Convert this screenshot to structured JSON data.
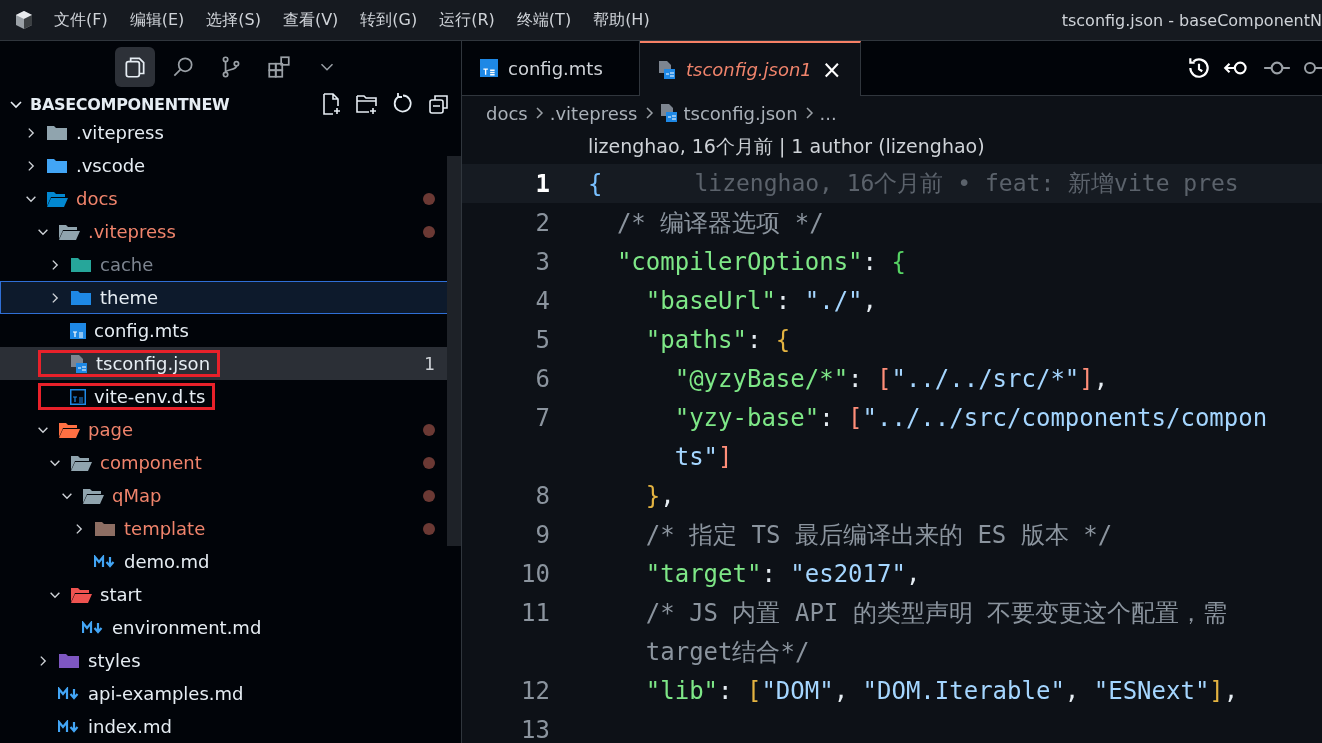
{
  "menu": [
    "文件(F)",
    "编辑(E)",
    "选择(S)",
    "查看(V)",
    "转到(G)",
    "运行(R)",
    "终端(T)",
    "帮助(H)"
  ],
  "window": {
    "title": "tsconfig.json - baseComponentN"
  },
  "activity": [
    {
      "kind": "files",
      "selected": true
    },
    {
      "kind": "search",
      "selected": false
    },
    {
      "kind": "source-control",
      "selected": false
    },
    {
      "kind": "extensions",
      "selected": false
    },
    {
      "kind": "chevron",
      "selected": false
    }
  ],
  "explorer": {
    "title": "BASECOMPONENTNEW",
    "tree": [
      {
        "name": ".vitepress",
        "kind": "folder",
        "expanded": false,
        "modified": false,
        "selected": false
      },
      {
        "name": ".vscode",
        "kind": "folder-vscode",
        "expanded": false,
        "modified": false,
        "selected": false
      },
      {
        "name": "docs",
        "kind": "folder-docs",
        "expanded": true,
        "modified": true,
        "selected": false,
        "children": [
          {
            "name": ".vitepress",
            "kind": "folder",
            "expanded": true,
            "modified": true,
            "selected": false,
            "children": [
              {
                "name": "cache",
                "kind": "folder-cache",
                "expanded": false,
                "modified": false,
                "ignored": true,
                "selected": false
              },
              {
                "name": "theme",
                "kind": "folder-theme",
                "expanded": false,
                "modified": false,
                "focused": true,
                "selected": false
              },
              {
                "name": "config.mts",
                "kind": "ts",
                "modified": false,
                "selected": false
              },
              {
                "name": "tsconfig.json",
                "kind": "tsconfig",
                "modified": false,
                "selected": true,
                "problems": "1",
                "marked": true
              },
              {
                "name": "vite-env.d.ts",
                "kind": "ts-outline",
                "modified": false,
                "selected": false,
                "marked": true
              }
            ]
          },
          {
            "name": "page",
            "kind": "folder-page",
            "expanded": true,
            "modified": true,
            "selected": false,
            "children": [
              {
                "name": "component",
                "kind": "folder",
                "expanded": true,
                "modified": true,
                "selected": false,
                "children": [
                  {
                    "name": "qMap",
                    "kind": "folder",
                    "expanded": true,
                    "modified": true,
                    "selected": false,
                    "children": [
                      {
                        "name": "template",
                        "kind": "folder-template",
                        "expanded": false,
                        "modified": true,
                        "selected": false
                      },
                      {
                        "name": "demo.md",
                        "kind": "md",
                        "modified": false,
                        "selected": false
                      }
                    ]
                  }
                ]
              },
              {
                "name": "start",
                "kind": "folder-start",
                "expanded": true,
                "modified": false,
                "selected": false,
                "children": [
                  {
                    "name": "environment.md",
                    "kind": "md",
                    "modified": false,
                    "selected": false
                  }
                ]
              }
            ]
          },
          {
            "name": "styles",
            "kind": "folder-css",
            "expanded": false,
            "modified": false,
            "selected": false
          },
          {
            "name": "api-examples.md",
            "kind": "md",
            "modified": false,
            "selected": false
          },
          {
            "name": "index.md",
            "kind": "md",
            "modified": false,
            "selected": false
          }
        ]
      }
    ]
  },
  "tabs": [
    {
      "label": "config.mts",
      "kind": "ts",
      "selected": false
    },
    {
      "label": "tsconfig.json",
      "problems": "1",
      "kind": "tsconfig",
      "selected": true,
      "close": "×"
    }
  ],
  "breadcrumbs": [
    "docs",
    ".vitepress",
    "tsconfig.json",
    "..."
  ],
  "codelens": "lizenghao, 16个月前 | 1 author (lizenghao)",
  "lines": [
    {
      "kind": "line",
      "number": "1",
      "current": true,
      "blame": "lizenghao, 16个月前 • feat: 新增vite pres",
      "tokens": [
        {
          "kind": "bracket-blue",
          "text": "{"
        }
      ]
    },
    {
      "kind": "line",
      "number": "2",
      "current": false,
      "tokens": [
        {
          "kind": "comment",
          "text": "  /* 编译器选项 */"
        }
      ]
    },
    {
      "kind": "line",
      "number": "3",
      "current": false,
      "tokens": [
        {
          "kind": "key",
          "text": "  \"compilerOptions\""
        },
        {
          "kind": "punct",
          "text": ": "
        },
        {
          "kind": "bracket-green",
          "text": "{"
        }
      ]
    },
    {
      "kind": "line",
      "number": "4",
      "current": false,
      "tokens": [
        {
          "kind": "key",
          "text": "    \"baseUrl\""
        },
        {
          "kind": "punct",
          "text": ": "
        },
        {
          "kind": "string",
          "text": "\"./\""
        },
        {
          "kind": "punct",
          "text": ","
        }
      ]
    },
    {
      "kind": "line",
      "number": "5",
      "current": false,
      "tokens": [
        {
          "kind": "key",
          "text": "    \"paths\""
        },
        {
          "kind": "punct",
          "text": ": "
        },
        {
          "kind": "bracket-gold",
          "text": "{"
        }
      ]
    },
    {
      "kind": "line",
      "number": "6",
      "current": false,
      "tokens": [
        {
          "kind": "key",
          "text": "      \"@yzyBase/*\""
        },
        {
          "kind": "punct",
          "text": ": "
        },
        {
          "kind": "bracket-red",
          "text": "["
        },
        {
          "kind": "string",
          "text": "\"../../src/*\""
        },
        {
          "kind": "bracket-red",
          "text": "]"
        },
        {
          "kind": "punct",
          "text": ","
        }
      ]
    },
    {
      "kind": "line",
      "number": "7",
      "current": false,
      "tokens": [
        {
          "kind": "key",
          "text": "      \"yzy-base\""
        },
        {
          "kind": "punct",
          "text": ": "
        },
        {
          "kind": "bracket-red",
          "text": "["
        },
        {
          "kind": "string",
          "text": "\"../../src/components/compon"
        }
      ]
    },
    {
      "kind": "wrap",
      "tokens": [
        {
          "kind": "string",
          "text": "      ts\""
        },
        {
          "kind": "bracket-red",
          "text": "]"
        }
      ]
    },
    {
      "kind": "line",
      "number": "8",
      "current": false,
      "tokens": [
        {
          "kind": "bracket-gold",
          "text": "    }"
        },
        {
          "kind": "punct",
          "text": ","
        }
      ]
    },
    {
      "kind": "line",
      "number": "9",
      "current": false,
      "tokens": [
        {
          "kind": "comment",
          "text": "    /* 指定 TS 最后编译出来的 ES 版本 */"
        }
      ]
    },
    {
      "kind": "line",
      "number": "10",
      "current": false,
      "tokens": [
        {
          "kind": "key",
          "text": "    \"target\""
        },
        {
          "kind": "punct",
          "text": ": "
        },
        {
          "kind": "string",
          "text": "\"es2017\""
        },
        {
          "kind": "punct",
          "text": ","
        }
      ]
    },
    {
      "kind": "line",
      "number": "11",
      "current": false,
      "tokens": [
        {
          "kind": "comment",
          "text": "    /* JS 内置 API 的类型声明 不要变更这个配置，需"
        }
      ]
    },
    {
      "kind": "wrap",
      "tokens": [
        {
          "kind": "comment",
          "text": "    target结合*/"
        }
      ]
    },
    {
      "kind": "line",
      "number": "12",
      "current": false,
      "tokens": [
        {
          "kind": "key",
          "text": "    \"lib\""
        },
        {
          "kind": "punct",
          "text": ": "
        },
        {
          "kind": "bracket-gold",
          "text": "["
        },
        {
          "kind": "string",
          "text": "\"DOM\""
        },
        {
          "kind": "punct",
          "text": ", "
        },
        {
          "kind": "string",
          "text": "\"DOM.Iterable\""
        },
        {
          "kind": "punct",
          "text": ", "
        },
        {
          "kind": "string",
          "text": "\"ESNext\""
        },
        {
          "kind": "bracket-gold",
          "text": "]"
        },
        {
          "kind": "punct",
          "text": ","
        }
      ]
    },
    {
      "kind": "line",
      "number": "13",
      "current": false
    }
  ]
}
